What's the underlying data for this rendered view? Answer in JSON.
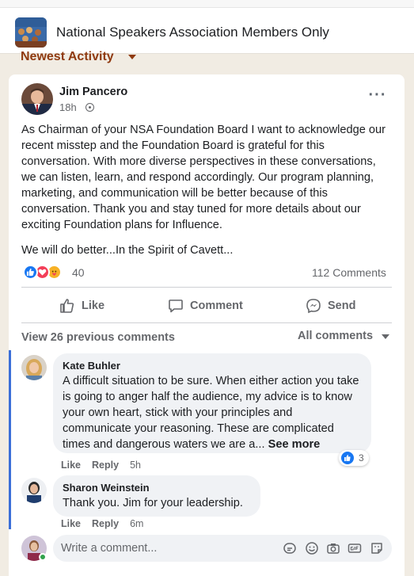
{
  "group": {
    "name": "National Speakers Association Members Only"
  },
  "feed": {
    "sort_label": "Newest Activity"
  },
  "post": {
    "author": "Jim Pancero",
    "time": "18h",
    "body": [
      "As Chairman of your NSA Foundation Board I want to acknowledge our recent misstep and the Foundation Board is grateful for this conversation.  With more diverse perspectives in these conversations, we can listen, learn, and respond accordingly.  Our program planning, marketing, and communication will be better because of this conversation. Thank you and stay tuned for more details about our exciting Foundation plans for Influence.",
      "We will do better...In the Spirit of Cavett..."
    ],
    "reactions": [
      "like",
      "love",
      "care"
    ],
    "reaction_count": "40",
    "comment_count": "112 Comments"
  },
  "actions": {
    "like": "Like",
    "comment": "Comment",
    "send": "Send"
  },
  "comments_section": {
    "view_previous": "View 26 previous comments",
    "filter": "All comments"
  },
  "comments": [
    {
      "author": "Kate Buhler",
      "text": "A difficult situation to be sure. When either action you take is going to anger half the audience, my advice is to know your own heart, stick with your principles and communicate your reasoning. These are complicated times and dangerous waters we are a...",
      "see_more": "See more",
      "like_label": "Like",
      "reply_label": "Reply",
      "time": "5h",
      "reaction_count": "3"
    },
    {
      "author": "Sharon Weinstein",
      "text": "Thank you. Jim for your leadership.",
      "like_label": "Like",
      "reply_label": "Reply",
      "time": "6m"
    }
  ],
  "composer": {
    "placeholder": "Write a comment...",
    "icons": [
      "sticker-icon",
      "emoji-icon",
      "camera-icon",
      "gif-icon",
      "avatar-sticker-icon"
    ]
  },
  "colors": {
    "accent": "#1877f2",
    "sort_label": "#8f3a10",
    "thread_line": "#3b6fd8",
    "page_bg": "#f1ece3"
  }
}
